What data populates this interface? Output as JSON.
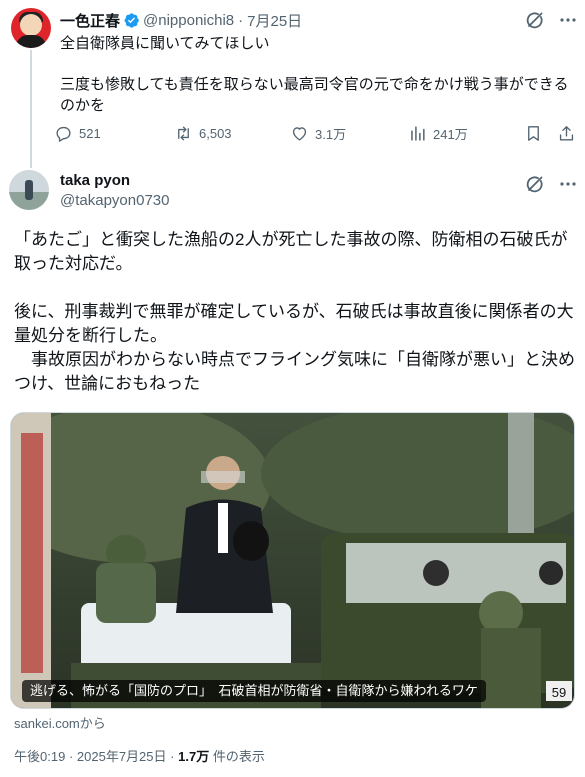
{
  "quoted_tweet": {
    "author_name": "一色正春",
    "handle": "@nipponichi8",
    "separator": "·",
    "date": "7月25日",
    "line1": "全自衛隊員に聞いてみてほしい",
    "line2": "三度も惨敗しても責任を取らない最高司令官の元で命をかけ戦う事ができるのかを",
    "verified_color": "#1d9bf0",
    "actions": {
      "replies": "521",
      "reposts": "6,503",
      "likes": "3.1万",
      "views": "241万"
    }
  },
  "main_tweet": {
    "author_name": "taka pyon",
    "handle": "@takapyon0730",
    "paragraph1": "「あたご」と衝突した漁船の2人が死亡した事故の際、防衛相の石破氏が取った対応だ。",
    "paragraph2": "後に、刑事裁判で無罪が確定しているが、石破氏は事故直後に関係者の大量処分を断行した。",
    "paragraph3": "　事故原因がわからない時点でフライング気味に「自衛隊が悪い」と決めつけ、世論におもねった",
    "media": {
      "caption": "逃げる、怖がる「国防のプロ」　石破首相が防衛省・自衛隊から嫌われるワケ",
      "plate_number": "59",
      "source": "sankei.comから"
    },
    "meta": {
      "time": "午後0:19",
      "separator": "·",
      "date": "2025年7月25日",
      "views_count": "1.7万",
      "views_label": "件の表示"
    }
  },
  "icons": {
    "verified": "verified-badge-icon",
    "grok": "grok-icon",
    "more": "more-options-icon",
    "reply": "reply-icon",
    "repost": "repost-icon",
    "like": "like-icon",
    "views": "views-icon",
    "bookmark": "bookmark-icon",
    "share": "share-icon"
  }
}
